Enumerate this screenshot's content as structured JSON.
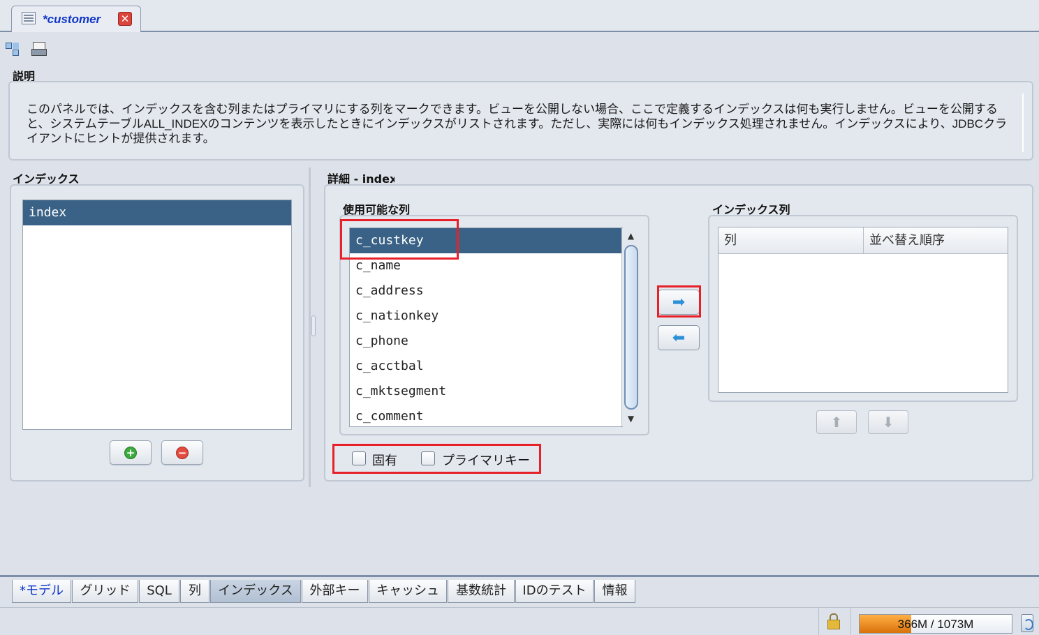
{
  "editor_tab": {
    "title": "*customer",
    "close_glyph": "✕"
  },
  "toolbar": {
    "icons": [
      "tree-view-icon",
      "print-icon"
    ]
  },
  "description": {
    "title": "説明",
    "text": "このパネルでは、インデックスを含む列またはプライマリにする列をマークできます。ビューを公開しない場合、ここで定義するインデックスは何も実行しません。ビューを公開すると、システムテーブルALL_INDEXのコンテンツを表示したときにインデックスがリストされます。ただし、実際には何もインデックス処理されません。インデックスにより、JDBCクライアントにヒントが提供されます。"
  },
  "index_panel": {
    "title": "インデックス",
    "items": [
      "index"
    ],
    "selected": "index",
    "add_icon": "add-icon",
    "remove_icon": "remove-icon"
  },
  "detail_panel": {
    "title": "詳細 - index",
    "available_columns": {
      "title": "使用可能な列",
      "items": [
        "c_custkey",
        "c_name",
        "c_address",
        "c_nationkey",
        "c_phone",
        "c_acctbal",
        "c_mktsegment",
        "c_comment"
      ],
      "selected": "c_custkey"
    },
    "move_right_glyph": "➡",
    "move_left_glyph": "⬅",
    "index_columns": {
      "title": "インデックス列",
      "headers": [
        "列",
        "並べ替え順序"
      ],
      "rows": []
    },
    "move_up_glyph": "⬆",
    "move_down_glyph": "⬇",
    "unique_label": "固有",
    "unique_checked": false,
    "primary_key_label": "プライマリキー",
    "primary_key_checked": false
  },
  "bottom_tabs": {
    "items": [
      "*モデル",
      "グリッド",
      "SQL",
      "列",
      "インデックス",
      "外部キー",
      "キャッシュ",
      "基数統計",
      "IDのテスト",
      "情報"
    ],
    "active": "インデックス"
  },
  "status_bar": {
    "memory_text": "366M / 1073M",
    "memory_used_fraction": 0.34
  },
  "colors": {
    "selection": "#3a6286",
    "highlight": "#e8202a",
    "tab_title": "#1036c9",
    "memory_fill": "#e8820f"
  }
}
